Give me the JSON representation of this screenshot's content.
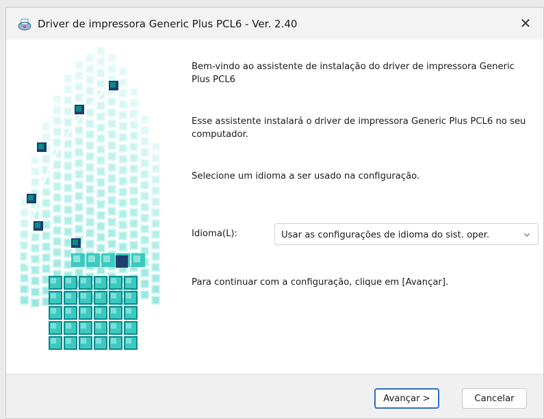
{
  "window": {
    "title": "Driver de impressora Generic Plus PCL6 - Ver. 2.40",
    "close_glyph": "✕",
    "icon": "printer-app-icon"
  },
  "main": {
    "welcome_text": "Bem-vindo ao assistente de instalação do driver de impressora Generic Plus PCL6",
    "install_text": "Esse assistente instalará o driver de impressora Generic Plus PCL6 no seu computador.",
    "select_language_text": "Selecione um idioma a ser usado na configuração.",
    "language_label": "Idioma(L):",
    "language_selected": "Usar as configurações de idioma do sist. oper.",
    "continue_text": "Para continuar com a configuração, clique em [Avançar]."
  },
  "footer": {
    "next_label": "Avançar >",
    "cancel_label": "Cancelar"
  },
  "colors": {
    "art_teal_light": "#a8f0e6",
    "art_teal": "#3cc9c0",
    "art_teal_dark": "#0b8a8e",
    "art_navy": "#1f3f6e",
    "default_button_border": "#2f6fbf"
  }
}
